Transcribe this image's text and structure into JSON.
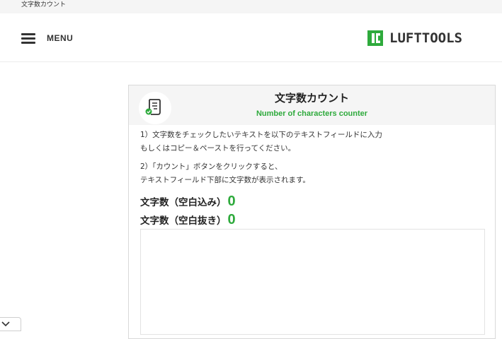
{
  "topbar": {
    "text": "文字数カウント"
  },
  "header": {
    "menu_label": "MENU",
    "logo_text": "LUFTTOOLS"
  },
  "tool": {
    "title": "文字数カウント",
    "subtitle": "Number of characters counter",
    "instructions": {
      "step1_line1": "1）文字数をチェックしたいテキストを以下のテキストフィールドに入力",
      "step1_line2": "もしくはコピー＆ペーストを行ってください。",
      "step2_line1": "2）「カウント」ボタンをクリックすると、",
      "step2_line2": "テキストフィールド下部に文字数が表示されます。"
    },
    "counts": {
      "with_spaces_label": "文字数（空白込み）",
      "with_spaces_value": "0",
      "without_spaces_label": "文字数（空白抜き）",
      "without_spaces_value": "0"
    },
    "textarea_value": ""
  },
  "colors": {
    "accent_green": "#2eaa3c",
    "header_bg": "#f5f5f5",
    "text_dark": "#333333"
  },
  "icons": {
    "menu": "hamburger-icon",
    "tool": "document-check-icon",
    "collapse": "chevron-down-icon"
  }
}
